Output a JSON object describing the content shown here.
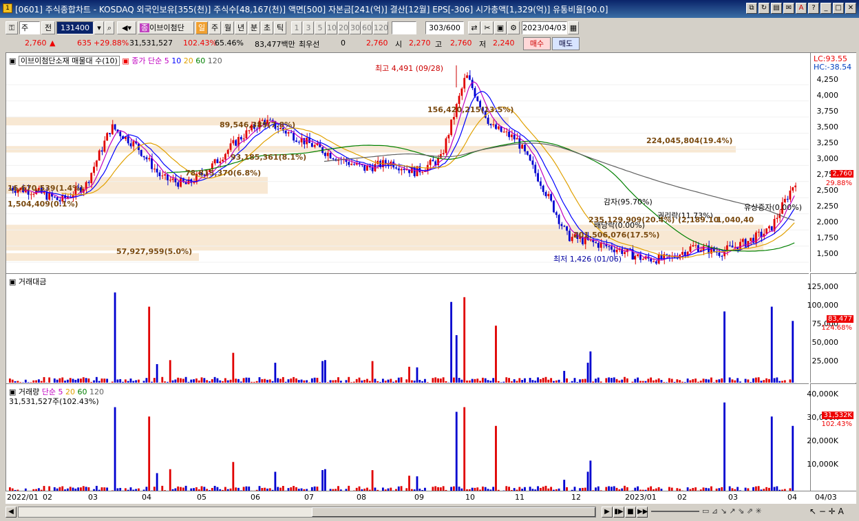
{
  "window": {
    "title": "[0601] 주식종합차트 - KOSDAQ 외국인보유[355(천)] 주식수[48,167(천)] 액면[500] 자본금[241(억)] 결산[12월] EPS[-306] 시가총액[1,329(억)] 유통비율[90.0]",
    "icon_label": "1"
  },
  "toolbar": {
    "period_select": "주",
    "prev_label": "전",
    "code_value": "131400",
    "stock_name": "이브이첨단",
    "interval_tabs": [
      "일",
      "주",
      "월",
      "년",
      "분",
      "초",
      "틱"
    ],
    "minute_options": [
      "1",
      "3",
      "5",
      "10",
      "20",
      "30",
      "60",
      "120"
    ],
    "count_value": "303/600",
    "date_value": "2023/04/03"
  },
  "quote": {
    "price": "2,760",
    "change": "635",
    "change_pct": "+29.88%",
    "volume": "31,531,527",
    "volume_ratio": "102.43%",
    "turnover_ratio": "65.46%",
    "amount": "83,477백만",
    "pref_label": "최우선",
    "pref_value": "0",
    "pref_price": "2,760",
    "open_label": "시",
    "open": "2,270",
    "high_label": "고",
    "high": "2,760",
    "low_label": "저",
    "low": "2,240",
    "buy_label": "매수",
    "sell_label": "매도"
  },
  "price_panel": {
    "title": "이브이첨단소재 매물대 수(10)",
    "ma_label": "종가 단순",
    "ma_periods": [
      "5",
      "10",
      "20",
      "60",
      "120"
    ],
    "lc": "LC:93.55",
    "hc": "HC:-38.54",
    "y_ticks": [
      "4,250",
      "4,000",
      "3,750",
      "3,500",
      "3,250",
      "3,000",
      "2,750",
      "2,500",
      "2,250",
      "2,000",
      "1,750",
      "1,500"
    ],
    "current_tag": "2,760",
    "current_pct": "29.88%",
    "annotations": {
      "high": "최고 4,491 (09/28)",
      "low": "최저 1,426 (01/06)",
      "reduction": "감자(95.70%)",
      "dividend": "배당락(0.00%)",
      "rights": "권리락(11.73%)",
      "paid_increase": "유상증자(0.00%)"
    },
    "volume_profile": [
      "156,420,215(13.5%)",
      "224,045,804(19.4%)",
      "89,546,389(7.8%)",
      "93,185,361(8.1%)",
      "78,815,370(6.8%)",
      "16,670,539(1.4%)",
      "1,504,409(0.1%)",
      "235,129,909(20.4%)",
      "201,506,076(17.5%)",
      "57,927,959(5.0%)",
      "1,040,40"
    ],
    "rights_value": "(2,189.10"
  },
  "amount_panel": {
    "title": "거래대금",
    "y_ticks": [
      "125,000",
      "100,000",
      "75,000",
      "50,000",
      "25,000"
    ],
    "current_tag": "83,477",
    "current_pct": "124.68%"
  },
  "volume_panel": {
    "title": "거래량",
    "ma_label": "단순",
    "ma_periods": [
      "5",
      "20",
      "60",
      "120"
    ],
    "value": "31,531,527주(102.43%)",
    "y_ticks": [
      "40,000K",
      "30,000K",
      "20,000K",
      "10,000K"
    ],
    "current_tag": "31,532K",
    "current_pct": "102.43%"
  },
  "x_axis": [
    "2022/01",
    "02",
    "03",
    "04",
    "05",
    "06",
    "07",
    "08",
    "09",
    "10",
    "11",
    "12",
    "2023/01",
    "02",
    "03",
    "04"
  ],
  "x_axis_right": "04/03",
  "colors": {
    "up": "#e00000",
    "down": "#0000d0",
    "band": "#f5e0c4",
    "ma5": "#c000c0",
    "ma10": "#0000ff",
    "ma20": "#e0a000",
    "ma60": "#008000",
    "ma120": "#606060"
  }
}
